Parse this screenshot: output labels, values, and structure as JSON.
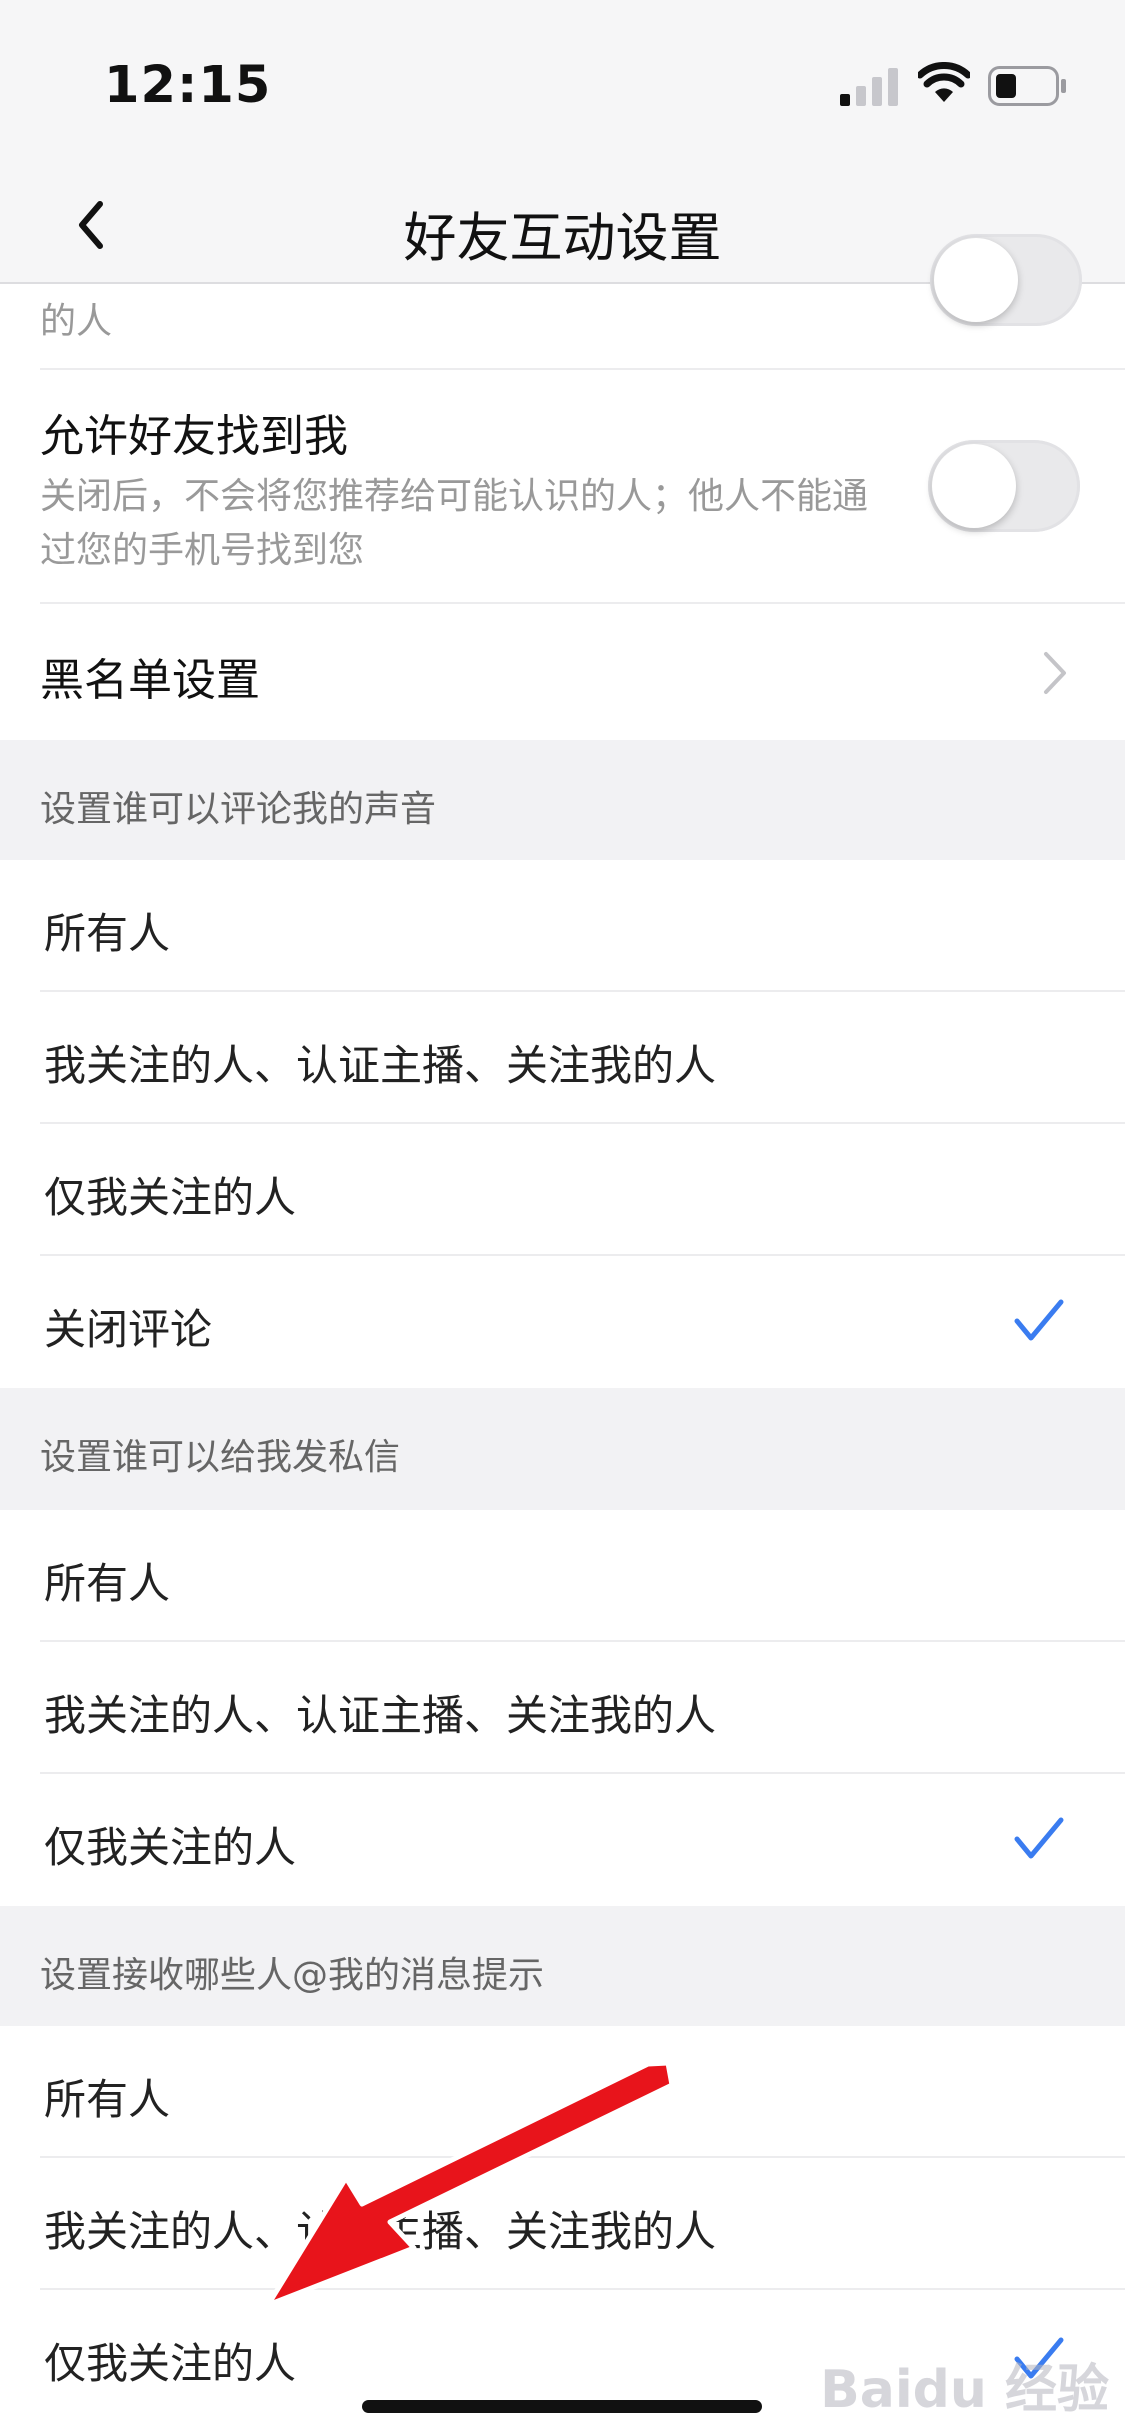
{
  "status": {
    "time": "12:15"
  },
  "nav": {
    "title": "好友互动设置"
  },
  "partial_item": {
    "desc_tail": "的人"
  },
  "allow_find": {
    "title": "允许好友找到我",
    "desc": "关闭后，不会将您推荐给可能认识的人；他人不能通过您的手机号找到您",
    "toggle_on": false
  },
  "blacklist": {
    "label": "黑名单设置"
  },
  "sections": [
    {
      "header": "设置谁可以评论我的声音",
      "options": [
        {
          "label": "所有人",
          "selected": false
        },
        {
          "label": "我关注的人、认证主播、关注我的人",
          "selected": false
        },
        {
          "label": "仅我关注的人",
          "selected": false
        },
        {
          "label": "关闭评论",
          "selected": true
        }
      ]
    },
    {
      "header": "设置谁可以给我发私信",
      "options": [
        {
          "label": "所有人",
          "selected": false
        },
        {
          "label": "我关注的人、认证主播、关注我的人",
          "selected": false
        },
        {
          "label": "仅我关注的人",
          "selected": true
        }
      ]
    },
    {
      "header": "设置接收哪些人@我的消息提示",
      "options": [
        {
          "label": "所有人",
          "selected": false
        },
        {
          "label": "我关注的人、认证主播、关注我的人",
          "selected": false
        },
        {
          "label": "仅我关注的人",
          "selected": true
        }
      ]
    }
  ],
  "colors": {
    "accent": "#3a7cf0",
    "annotation_arrow": "#e8141b"
  },
  "watermark": "Baidu 经验"
}
